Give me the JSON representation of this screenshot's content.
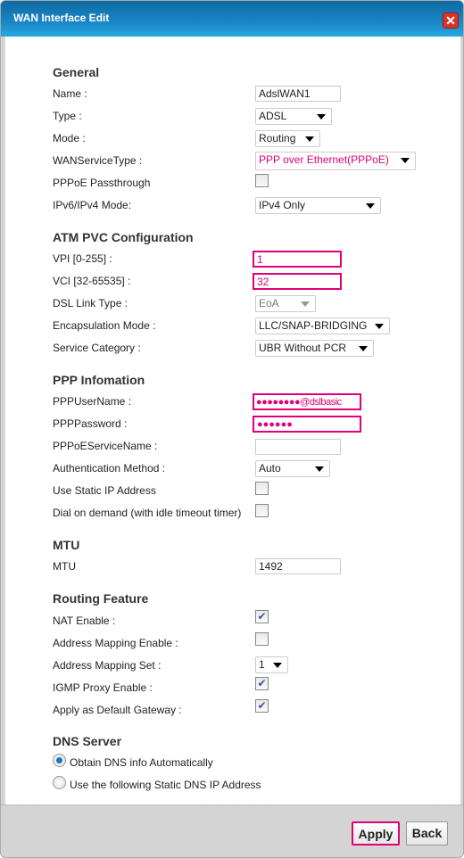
{
  "dialog": {
    "title": "WAN Interface Edit"
  },
  "general": {
    "heading": "General",
    "name_label": "Name :",
    "name_value": "AdslWAN1",
    "type_label": "Type :",
    "type_value": "ADSL",
    "mode_label": "Mode :",
    "mode_value": "Routing",
    "wan_label": "WANServiceType :",
    "wan_value": "PPP over Ethernet(PPPoE)",
    "passthrough_label": "PPPoE Passthrough",
    "passthrough_checked": false,
    "ipmode_label": "IPv6/IPv4 Mode:",
    "ipmode_value": "IPv4 Only"
  },
  "atm": {
    "heading": "ATM PVC Configuration",
    "vpi_label": "VPI [0-255] :",
    "vpi_value": "1",
    "vci_label": "VCI [32-65535] :",
    "vci_value": "32",
    "dsl_label": "DSL Link Type :",
    "dsl_value": "EoA",
    "encap_label": "Encapsulation Mode :",
    "encap_value": "LLC/SNAP-BRIDGING",
    "svc_label": "Service Category :",
    "svc_value": "UBR Without PCR"
  },
  "ppp": {
    "heading": "PPP Infomation",
    "user_label": "PPPUserName :",
    "user_value": "●●●●●●●●@dslbasic",
    "pass_label": "PPPPassword :",
    "pass_value": "●●●●●●",
    "svcname_label": "PPPoEServiceName :",
    "svcname_value": "",
    "auth_label": "Authentication Method :",
    "auth_value": "Auto",
    "static_label": "Use Static IP Address",
    "static_checked": false,
    "dial_label": "Dial on demand (with idle timeout timer)",
    "dial_checked": false
  },
  "mtu": {
    "heading": "MTU",
    "label": "MTU",
    "value": "1492"
  },
  "routing": {
    "heading": "Routing Feature",
    "nat_label": "NAT Enable :",
    "nat_checked": true,
    "am_enable_label": "Address Mapping Enable :",
    "am_enable_checked": false,
    "am_set_label": "Address Mapping Set :",
    "am_set_value": "1",
    "igmp_label": "IGMP Proxy Enable :",
    "igmp_checked": true,
    "gw_label": "Apply as Default Gateway :",
    "gw_checked": true
  },
  "dns": {
    "heading": "DNS Server",
    "auto_label": "Obtain DNS info Automatically",
    "static_label": "Use the following Static DNS IP Address",
    "selected": "auto"
  },
  "footer": {
    "apply": "Apply",
    "back": "Back"
  },
  "colors": {
    "highlight": "#e0007a",
    "title_bar": "#1a86c6"
  },
  "icons": {
    "check": "✔",
    "close": "✕"
  }
}
